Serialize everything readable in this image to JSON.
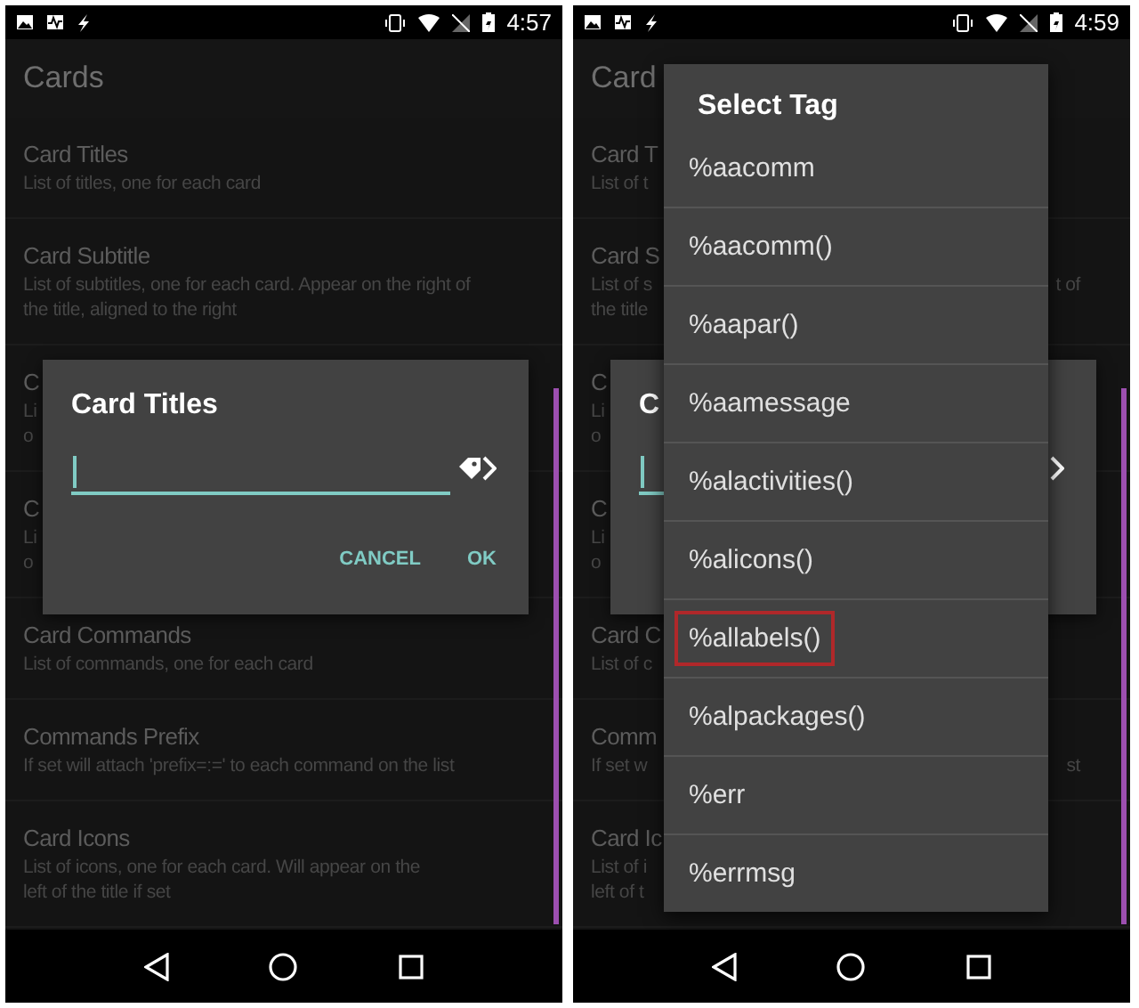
{
  "screens": [
    {
      "status_bar": {
        "time": "4:57"
      },
      "app_bar": {
        "title": "Cards"
      },
      "list": [
        {
          "title": "Card Titles",
          "lines": [
            {
              "text": "List of titles, one for each card"
            }
          ]
        },
        {
          "title": "Card Subtitle",
          "lines": [
            {
              "text": "List of subtitles, one for each card. Appear on the right of"
            },
            {
              "text": "the title, aligned to the right"
            }
          ]
        },
        {
          "title": "C",
          "lines": [
            {
              "text": "Li"
            },
            {
              "text": "o"
            }
          ]
        },
        {
          "title": "C",
          "lines": [
            {
              "text": "Li"
            },
            {
              "text": "o"
            }
          ]
        },
        {
          "title": "Card Commands",
          "lines": [
            {
              "text": "List of commands, one for each card"
            }
          ]
        },
        {
          "title": "Commands Prefix",
          "lines": [
            {
              "text": "If set will attach 'prefix=:=' to each command on the list"
            }
          ]
        },
        {
          "title": "Card Icons",
          "lines": [
            {
              "text": "List of icons, one for each card. Will appear on the"
            },
            {
              "text": "left of the title if set"
            }
          ]
        }
      ],
      "dialog": {
        "title": "Card Titles",
        "field": {
          "focused": true
        },
        "buttons": [
          "CANCEL",
          "OK"
        ]
      }
    },
    {
      "status_bar": {
        "time": "4:59"
      },
      "app_bar": {
        "title": "Card"
      },
      "list": [
        {
          "title": "Card T",
          "lines": [
            {
              "text": "List of t"
            }
          ]
        },
        {
          "title": "Card S",
          "lines": [
            {
              "text": "List of s",
              "tail": "t of"
            },
            {
              "text": "the title"
            }
          ]
        },
        {
          "title": "C",
          "lines": [
            {
              "text": "Li"
            },
            {
              "text": "o"
            }
          ]
        },
        {
          "title": "C",
          "lines": [
            {
              "text": "Li"
            },
            {
              "text": "o"
            }
          ]
        },
        {
          "title": "Card C",
          "lines": [
            {
              "text": "List of c"
            }
          ]
        },
        {
          "title": "Comm",
          "lines": [
            {
              "text": "If set w",
              "tail": "st"
            }
          ]
        },
        {
          "title": "Card Ic",
          "lines": [
            {
              "text": "List of i"
            },
            {
              "text": "left of t"
            }
          ]
        }
      ],
      "dialog": {
        "title": "C",
        "field": {
          "focused": true
        }
      },
      "menu": {
        "title": "Select Tag",
        "items": [
          {
            "label": "%aacomm",
            "selected": false
          },
          {
            "label": "%aacomm()",
            "selected": false
          },
          {
            "label": "%aapar()",
            "selected": false
          },
          {
            "label": "%aamessage",
            "selected": false
          },
          {
            "label": "%alactivities()",
            "selected": false
          },
          {
            "label": "%alicons()",
            "selected": false
          },
          {
            "label": "%allabels()",
            "selected": true
          },
          {
            "label": "%alpackages()",
            "selected": false
          },
          {
            "label": "%err",
            "selected": false
          },
          {
            "label": "%errmsg",
            "selected": false
          }
        ]
      }
    }
  ]
}
